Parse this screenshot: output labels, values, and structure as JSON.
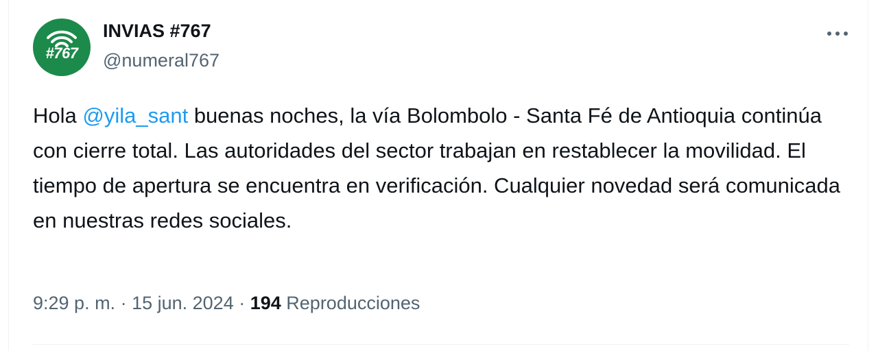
{
  "author": {
    "display_name": "INVIAS #767",
    "handle": "@numeral767",
    "avatar_text": "#767",
    "avatar_color": "#1c8a4a"
  },
  "tweet": {
    "text_before": "Hola ",
    "mention": "@yila_sant",
    "text_after": " buenas noches, la vía Bolombolo - Santa Fé de Antioquia continúa con cierre total. Las autoridades del sector trabajan en restablecer la movilidad. El tiempo de apertura se encuentra en verificación. Cualquier novedad será comunicada en nuestras redes sociales."
  },
  "meta": {
    "time": "9:29 p. m.",
    "separator": " · ",
    "date": "15 jun. 2024",
    "views_count": "194",
    "views_label": " Reproducciones"
  },
  "colors": {
    "mention": "#1d9bf0",
    "secondary_text": "#536471",
    "primary_text": "#0f1419"
  },
  "icons": {
    "more": "more-horizontal-icon",
    "avatar_wifi": "wifi-signal-icon"
  }
}
